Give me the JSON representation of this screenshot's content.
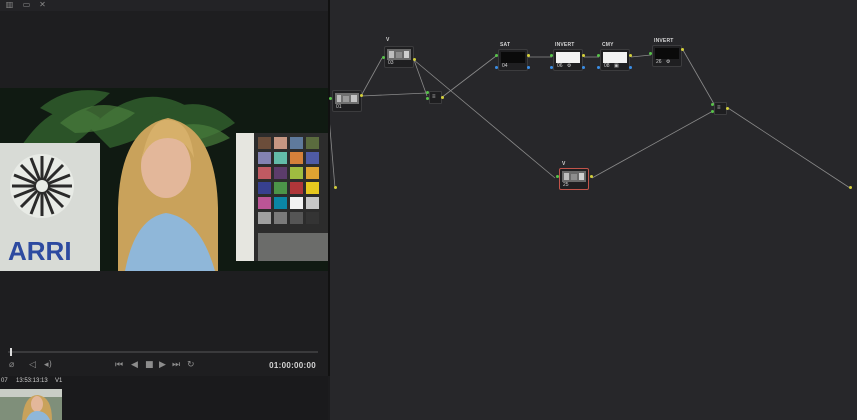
{
  "viewer": {
    "timecode": "01:00:00:00",
    "brand_logo_text": "ARRI"
  },
  "toolbar_icons": [
    "layout-icon",
    "split-view-icon",
    "wipe-icon"
  ],
  "transport": {
    "controls": [
      "first-frame-icon",
      "reverse-play-icon",
      "stop-icon",
      "play-icon",
      "last-frame-icon",
      "loop-icon"
    ]
  },
  "clip": {
    "number": "07",
    "timecode": "13:53:13:13",
    "track": "V1"
  },
  "nodes": [
    {
      "id": "node-01",
      "number": "01",
      "label": ""
    },
    {
      "id": "node-03",
      "number": "03",
      "label": "V"
    },
    {
      "id": "node-04",
      "number": "04",
      "label": "SAT"
    },
    {
      "id": "node-06",
      "number": "06",
      "label": "INVERT",
      "icon": "⚙"
    },
    {
      "id": "node-08",
      "number": "08",
      "label": "CMY",
      "icon": "▣"
    },
    {
      "id": "node-26",
      "number": "26",
      "label": "INVERT",
      "icon": "⚙"
    },
    {
      "id": "node-25",
      "number": "25",
      "label": "V"
    }
  ],
  "colors": {
    "link": "#8a8a8a",
    "input_dot": "#58c24a",
    "output_dot": "#d3cf3b",
    "key_dot": "#3a8ee6",
    "selected_border": "#c2544a"
  }
}
